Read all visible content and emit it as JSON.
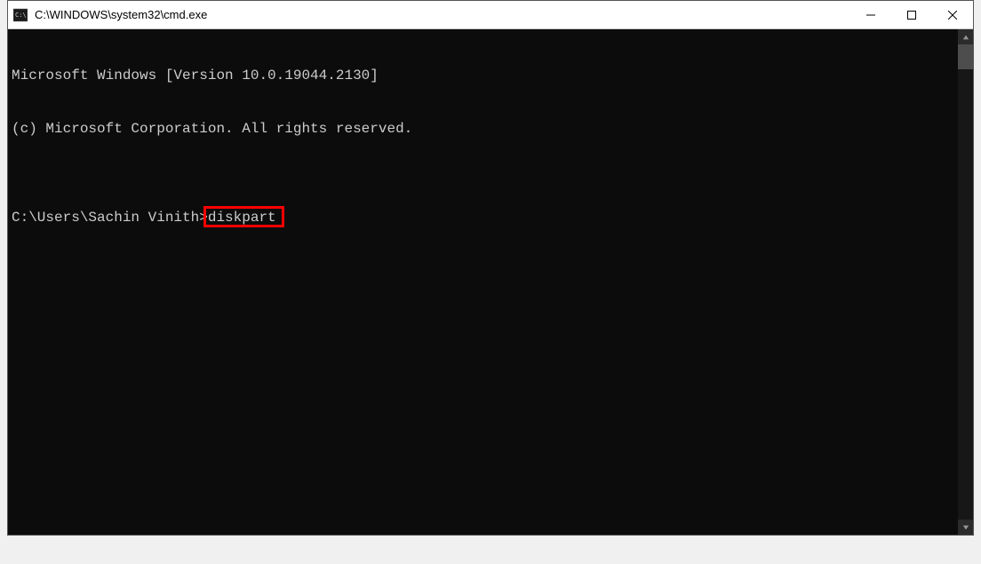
{
  "window": {
    "title": "C:\\WINDOWS\\system32\\cmd.exe"
  },
  "terminal": {
    "line1": "Microsoft Windows [Version 10.0.19044.2130]",
    "line2": "(c) Microsoft Corporation. All rights reserved.",
    "blank": "",
    "prompt": "C:\\Users\\Sachin Vinith>",
    "command": "diskpart"
  },
  "annotation": {
    "highlight_target": "diskpart"
  }
}
